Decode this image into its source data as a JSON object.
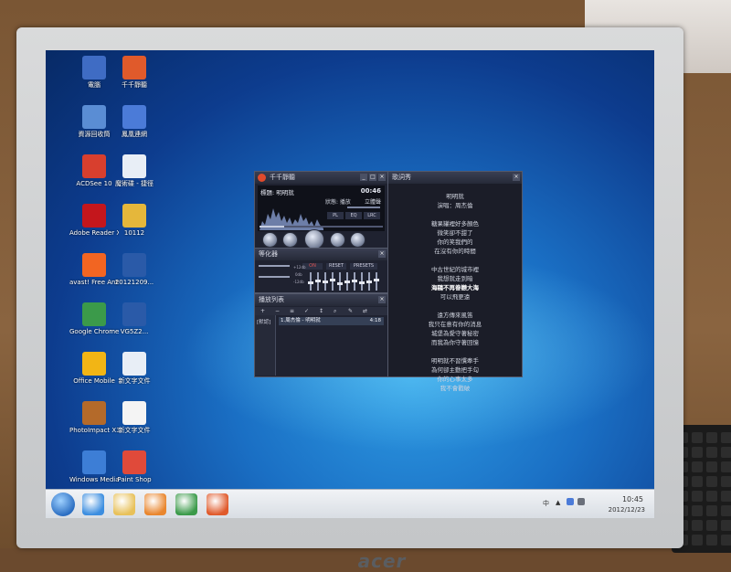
{
  "desktop": {
    "icons": [
      {
        "label": "電腦",
        "color": "#3f6cc4"
      },
      {
        "label": "千千靜聽",
        "color": "#e05a2b"
      },
      {
        "label": "資源回收筒",
        "color": "#5a8dd4"
      },
      {
        "label": "鳳凰連網",
        "color": "#4b7bd8"
      },
      {
        "label": "ACDSee 10",
        "color": "#d83f2e"
      },
      {
        "label": "魔術碟 - 捷徑",
        "color": "#e8eef6"
      },
      {
        "label": "Adobe Reader XI",
        "color": "#c4161c"
      },
      {
        "label": "10112",
        "color": "#e5b73b"
      },
      {
        "label": "avast! Free Antivirus",
        "color": "#f26522"
      },
      {
        "label": "20121209...",
        "color": "#2a5aa8"
      },
      {
        "label": "Google Chrome",
        "color": "#3b9a4a"
      },
      {
        "label": "VG5Z2...",
        "color": "#2a5aa8"
      },
      {
        "label": "Office Mobile",
        "color": "#f2b515"
      },
      {
        "label": "新文字文件",
        "color": "#e8eef6"
      },
      {
        "label": "PhotoImpact X3",
        "color": "#b46a2a"
      },
      {
        "label": "新文字文件",
        "color": "#f4f4f4"
      },
      {
        "label": "Windows Media Center",
        "color": "#3d7ed6"
      },
      {
        "label": "Paint Shop",
        "color": "#e04a3a"
      }
    ]
  },
  "player": {
    "main": {
      "title": "千千靜聽",
      "song_label": "標題: 明明就",
      "time": "00:46",
      "status": "狀態: 播放",
      "mode": "立體聲",
      "mini_buttons": [
        "PL",
        "EQ",
        "LRC"
      ]
    },
    "eq": {
      "title": "等化器",
      "buttons": [
        "ON",
        "RESET",
        "PRESETS"
      ],
      "bands": [
        0.45,
        0.55,
        0.5,
        0.6,
        0.4,
        0.5,
        0.55,
        0.45,
        0.5,
        0.6
      ],
      "db_labels": [
        "+12db",
        "0db",
        "-12db"
      ]
    },
    "playlist": {
      "title": "播放列表",
      "group": "[默認]",
      "item": "1.周杰倫 - 明明就",
      "duration": "4:18"
    },
    "lyrics": {
      "title": "歌詞秀",
      "lines": [
        {
          "text": "明明就",
          "hi": false
        },
        {
          "text": "演唱：周杰倫",
          "hi": false
        },
        {
          "text": "",
          "hi": false
        },
        {
          "text": "糖果罐裡好多顏色",
          "hi": false
        },
        {
          "text": "微笑卻不甜了",
          "hi": false
        },
        {
          "text": "你的笑我們的",
          "hi": false
        },
        {
          "text": "在沒有你的時間",
          "hi": false
        },
        {
          "text": "",
          "hi": false
        },
        {
          "text": "中古世紀的城市裡",
          "hi": false
        },
        {
          "text": "我想就走到暗",
          "hi": false
        },
        {
          "text": "海鷗不再眷戀大海",
          "hi": true
        },
        {
          "text": "可以飛更遠",
          "hi": false
        },
        {
          "text": "",
          "hi": false
        },
        {
          "text": "遠方傳來風笛",
          "hi": false
        },
        {
          "text": "我只在意有你的消息",
          "hi": false
        },
        {
          "text": "城堡為愛守著秘密",
          "hi": false
        },
        {
          "text": "而我為你守著回憶",
          "hi": false
        },
        {
          "text": "",
          "hi": false
        },
        {
          "text": "明明就不習慣牽手",
          "hi": false
        },
        {
          "text": "為何卻主動把手勾",
          "hi": false
        },
        {
          "text": "你的心事太多",
          "hi": false
        },
        {
          "text": "我不會戳破",
          "hi": false
        }
      ]
    }
  },
  "taskbar": {
    "pinned": [
      {
        "name": "ie-icon",
        "color": "#3c8ee0"
      },
      {
        "name": "explorer-icon",
        "color": "#e8c15a"
      },
      {
        "name": "media-player-icon",
        "color": "#e9862e"
      },
      {
        "name": "chrome-icon",
        "color": "#3b9a4a"
      },
      {
        "name": "ttplayer-icon",
        "color": "#e05a2b"
      }
    ],
    "time": "10:45",
    "date": "2012/12/23",
    "ime": "中"
  },
  "monitor": {
    "brand": "acer"
  }
}
